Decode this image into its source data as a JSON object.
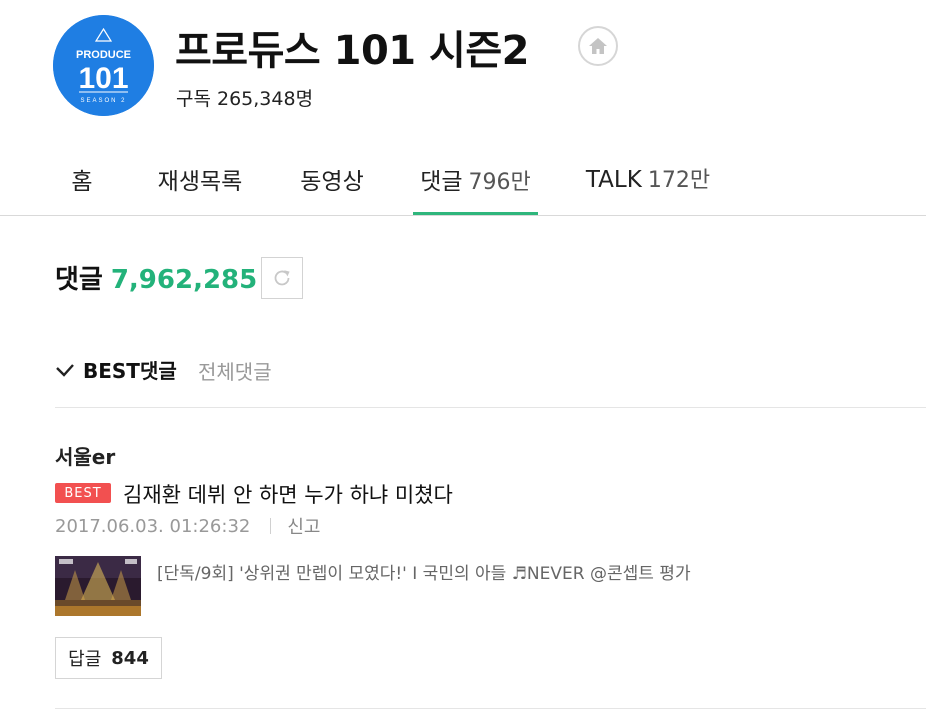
{
  "channel": {
    "logo_text_top": "PRODUCE",
    "logo_text_main": "101",
    "logo_text_bottom": "SEASON 2",
    "title": "프로듀스 101 시즌2",
    "subscriber_text": "구독 265,348명",
    "home_icon": "home-icon",
    "brand_color": "#1f7ee3"
  },
  "tabs": [
    {
      "label": "홈",
      "count": ""
    },
    {
      "label": "재생목록",
      "count": ""
    },
    {
      "label": "동영상",
      "count": ""
    },
    {
      "label": "댓글",
      "count": "796만"
    },
    {
      "label": "TALK",
      "count": "172만"
    }
  ],
  "active_tab_color": "#2fb67c",
  "comments": {
    "label": "댓글",
    "total": "7,962,285",
    "total_color": "#23b27a",
    "refresh_icon": "refresh-icon",
    "sort_best": "BEST댓글",
    "sort_all": "전체댓글"
  },
  "comment": {
    "author": "서울er",
    "badge": "BEST",
    "badge_color": "#f25050",
    "text": "김재환 데뷔 안 하면 누가 하냐 미쳤다",
    "date": "2017.06.03. 01:26:32",
    "report": "신고",
    "video_title": "[단독/9회] '상위권 만렙이 모였다!' I 국민의 아들 ♬NEVER @콘셉트 평가",
    "reply_label": "답글",
    "reply_count": "844"
  }
}
